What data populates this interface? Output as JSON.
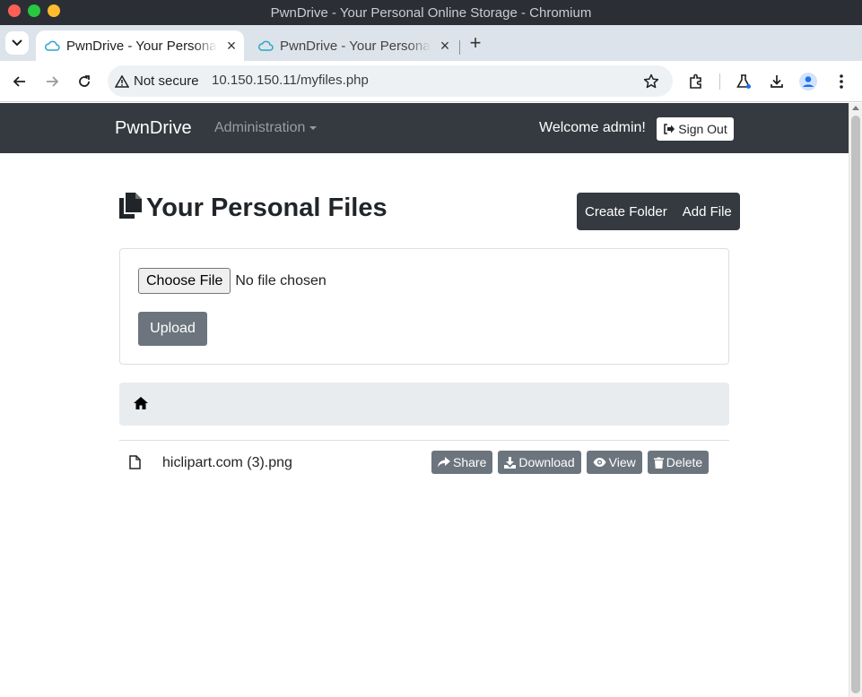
{
  "window": {
    "title": "PwnDrive - Your Personal Online Storage - Chromium"
  },
  "tabs": [
    {
      "title": "PwnDrive - Your Personal Online Storage",
      "active": true
    },
    {
      "title": "PwnDrive - Your Personal Online Storage",
      "active": false
    }
  ],
  "toolbar": {
    "security_label": "Not secure",
    "url": "10.150.150.11/myfiles.php"
  },
  "navbar": {
    "brand": "PwnDrive",
    "admin_menu": "Administration",
    "welcome": "Welcome admin!",
    "signout": "Sign Out"
  },
  "page": {
    "title": "Your Personal Files",
    "create_folder": "Create Folder",
    "add_file": "Add File"
  },
  "upload": {
    "choose_file": "Choose File",
    "no_file": "No file chosen",
    "upload_button": "Upload"
  },
  "files": [
    {
      "name": "hiclipart.com (3).png",
      "actions": {
        "share": "Share",
        "download": "Download",
        "view": "View",
        "delete": "Delete"
      }
    }
  ],
  "colors": {
    "navbar_bg": "#343a40",
    "secondary_btn": "#6c757d",
    "breadcrumb_bg": "#e9ecef"
  },
  "icons": {
    "page_header": "copy-icon",
    "breadcrumb": "home-icon",
    "file": "file-icon"
  }
}
